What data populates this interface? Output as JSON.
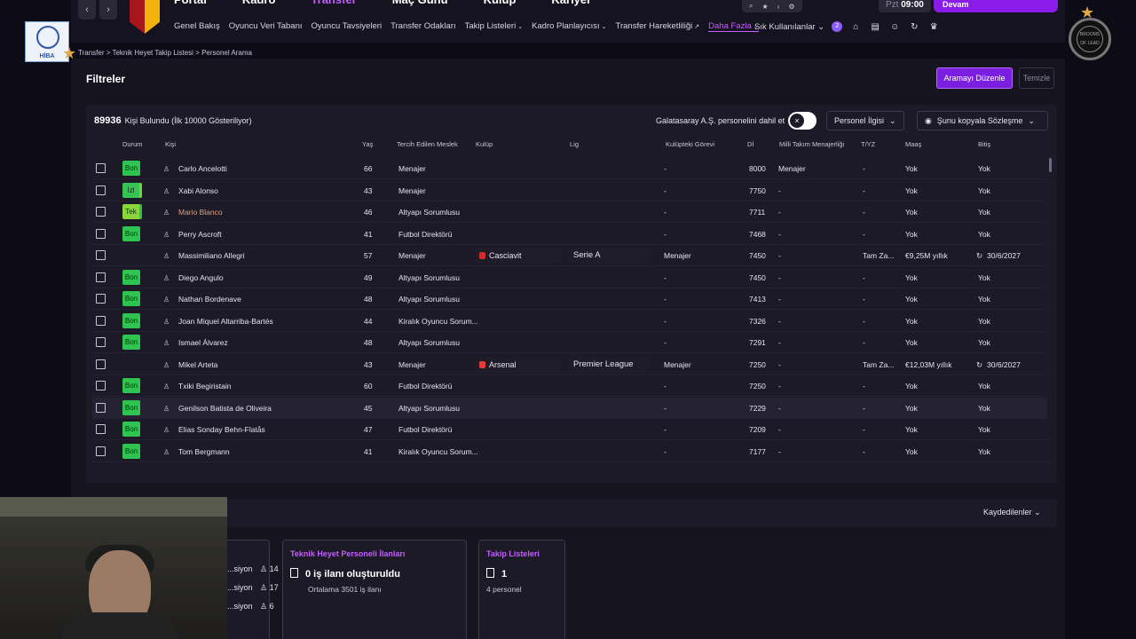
{
  "nav": {
    "back": "‹",
    "forward": "›",
    "main_tabs": [
      "Portal",
      "Kadro",
      "Transfer",
      "Maç Günü",
      "Kulüp",
      "Kariyer"
    ],
    "menu_items": [
      {
        "label": "Genel Bakış",
        "caret": false
      },
      {
        "label": "Oyuncu Veri Tabanı",
        "caret": false
      },
      {
        "label": "Oyuncu Tavsiyeleri",
        "caret": false
      },
      {
        "label": "Transfer Odakları",
        "caret": false
      },
      {
        "label": "Takip Listeleri",
        "caret": true
      },
      {
        "label": "Kadro Planlayıcısı",
        "caret": true
      },
      {
        "label": "Transfer Hareketliliği",
        "caret": false,
        "external": true
      },
      {
        "label": "Daha Fazla",
        "caret": true,
        "active": true
      }
    ],
    "quick_access": "Sık Kullanılanlar",
    "notification_count": "2",
    "date_day": "Pzt",
    "date_time": "09:00",
    "continue_label": "Devam"
  },
  "logos": {
    "left_text": "HİBA",
    "right_text": "BROOMS OF LEAD"
  },
  "breadcrumb": {
    "items": [
      "Transfer",
      "Teknik Heyet Takip Listesi",
      "Personel Arama"
    ]
  },
  "filters": {
    "title": "Filtreler",
    "edit_search": "Aramayı Düzenle",
    "clear": "Temizle"
  },
  "results": {
    "count": "89936",
    "count_text": "Kişi Bulundu (İlk 10000 Gösteriliyor)",
    "include_label": "Galatasaray A.Ş. personelini dahil et",
    "toggle_symbol": "×",
    "staff_dropdown": "Personel İlgisi",
    "contract_dropdown": "Şunu kopyala Sözleşme"
  },
  "columns": [
    "Durum",
    "Kişi",
    "Yaş",
    "Tercih Edilen Meslek",
    "Kulüp",
    "Lig",
    "Kulüpteki Görevi",
    "Dİ",
    "Milli Takım Menajerliği",
    "T/YZ",
    "Maaş",
    "Bitiş"
  ],
  "rows": [
    {
      "status": "Bon",
      "status_type": "bon",
      "name": "Carlo Ancelotti",
      "age": "66",
      "role": "Menajer",
      "club": "",
      "club_color": "",
      "league": "",
      "club_role": "-",
      "di": "8000",
      "national": "Menajer",
      "tyz": "-",
      "salary": "Yok",
      "end": "Yok",
      "highlight": false
    },
    {
      "status": "İzl",
      "status_type": "izl",
      "name": "Xabi Alonso",
      "age": "43",
      "role": "Menajer",
      "club": "",
      "club_color": "",
      "league": "",
      "club_role": "-",
      "di": "7750",
      "national": "-",
      "tyz": "-",
      "salary": "Yok",
      "end": "Yok",
      "highlight": false
    },
    {
      "status": "Tek",
      "status_type": "tek",
      "name": "Mario Blanco",
      "age": "46",
      "role": "Altyapı Sorumlusu",
      "club": "",
      "club_color": "",
      "league": "",
      "club_role": "-",
      "di": "7711",
      "national": "-",
      "tyz": "-",
      "salary": "Yok",
      "end": "Yok",
      "highlight": false,
      "name_color": "#e0a07a"
    },
    {
      "status": "Bon",
      "status_type": "bon",
      "name": "Perry Ascroft",
      "age": "41",
      "role": "Futbol Direktörü",
      "club": "",
      "club_color": "",
      "league": "",
      "club_role": "-",
      "di": "7468",
      "national": "-",
      "tyz": "-",
      "salary": "Yok",
      "end": "Yok",
      "highlight": false
    },
    {
      "status": "",
      "status_type": "none",
      "name": "Massimiliano Allegri",
      "age": "57",
      "role": "Menajer",
      "club": "Casciavit",
      "club_color": "#d42a2a",
      "league": "Serie A",
      "club_role": "Menajer",
      "di": "7450",
      "national": "-",
      "tyz": "Tam Za...",
      "salary": "€9,25M yıllık",
      "end": "30/6/2027",
      "highlight": false
    },
    {
      "status": "Bon",
      "status_type": "bon",
      "name": "Diego Angulo",
      "age": "49",
      "role": "Altyapı Sorumlusu",
      "club": "",
      "club_color": "",
      "league": "",
      "club_role": "-",
      "di": "7450",
      "national": "-",
      "tyz": "-",
      "salary": "Yok",
      "end": "Yok",
      "highlight": false
    },
    {
      "status": "Bon",
      "status_type": "bon",
      "name": "Nathan Bordenave",
      "age": "48",
      "role": "Altyapı Sorumlusu",
      "club": "",
      "club_color": "",
      "league": "",
      "club_role": "-",
      "di": "7413",
      "national": "-",
      "tyz": "-",
      "salary": "Yok",
      "end": "Yok",
      "highlight": false
    },
    {
      "status": "Bon",
      "status_type": "bon",
      "name": "Joan Miquel Altarriba-Bartés",
      "age": "44",
      "role": "Kiralık Oyuncu Sorum...",
      "club": "",
      "club_color": "",
      "league": "",
      "club_role": "-",
      "di": "7326",
      "national": "-",
      "tyz": "-",
      "salary": "Yok",
      "end": "Yok",
      "highlight": false
    },
    {
      "status": "Bon",
      "status_type": "bon",
      "name": "Ismael Álvarez",
      "age": "48",
      "role": "Altyapı Sorumlusu",
      "club": "",
      "club_color": "",
      "league": "",
      "club_role": "-",
      "di": "7291",
      "national": "-",
      "tyz": "-",
      "salary": "Yok",
      "end": "Yok",
      "highlight": false
    },
    {
      "status": "",
      "status_type": "none",
      "name": "Mikel Arteta",
      "age": "43",
      "role": "Menajer",
      "club": "Arsenal",
      "club_color": "#e03a3a",
      "league": "Premier League",
      "club_role": "Menajer",
      "di": "7250",
      "national": "-",
      "tyz": "Tam Za...",
      "salary": "€12,03M yıllık",
      "end": "30/6/2027",
      "highlight": false
    },
    {
      "status": "Bon",
      "status_type": "bon",
      "name": "Txiki Begiristain",
      "age": "60",
      "role": "Futbol Direktörü",
      "club": "",
      "club_color": "",
      "league": "",
      "club_role": "-",
      "di": "7250",
      "national": "-",
      "tyz": "-",
      "salary": "Yok",
      "end": "Yok",
      "highlight": false
    },
    {
      "status": "Bon",
      "status_type": "bon",
      "name": "Genilson Batista de Oliveira",
      "age": "45",
      "role": "Altyapı Sorumlusu",
      "club": "",
      "club_color": "",
      "league": "",
      "club_role": "-",
      "di": "7229",
      "national": "-",
      "tyz": "-",
      "salary": "Yok",
      "end": "Yok",
      "highlight": true
    },
    {
      "status": "Bon",
      "status_type": "bon",
      "name": "Elias Sonday Behn-Flatås",
      "age": "47",
      "role": "Futbol Direktörü",
      "club": "",
      "club_color": "",
      "league": "",
      "club_role": "-",
      "di": "7209",
      "national": "-",
      "tyz": "-",
      "salary": "Yok",
      "end": "Yok",
      "highlight": false
    },
    {
      "status": "Bon",
      "status_type": "bon",
      "name": "Tom Bergmann",
      "age": "41",
      "role": "Kiralık Oyuncu Sorum...",
      "club": "",
      "club_color": "",
      "league": "",
      "club_role": "-",
      "di": "7177",
      "national": "-",
      "tyz": "-",
      "salary": "Yok",
      "end": "Yok",
      "highlight": false
    }
  ],
  "saved": {
    "label": "Kaydedilenler"
  },
  "cards": {
    "left_stats": [
      {
        "label": "...siyon",
        "value": "14"
      },
      {
        "label": "...siyon",
        "value": "17"
      },
      {
        "label": "...siyon",
        "value": "6"
      }
    ],
    "staff_ads": {
      "title": "Teknik Heyet Personeli İlanları",
      "value": "0 iş ilanı oluşturuldu",
      "sub": "Ortalama 3501 iş ilanı"
    },
    "watchlists": {
      "title": "Takip Listeleri",
      "value": "1",
      "sub": "4 personel"
    }
  }
}
